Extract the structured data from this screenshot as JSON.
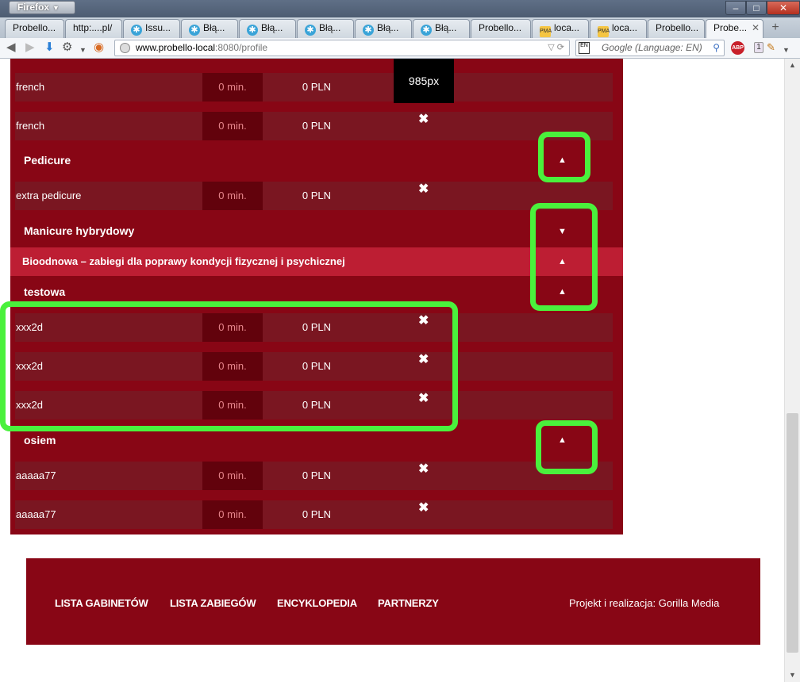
{
  "browser": {
    "menu_button": "Firefox",
    "tabs": [
      {
        "label": "Probello..."
      },
      {
        "label": "http:....pl/"
      },
      {
        "label": "Issu..."
      },
      {
        "label": "Błą..."
      },
      {
        "label": "Błą..."
      },
      {
        "label": "Błą..."
      },
      {
        "label": "Błą..."
      },
      {
        "label": "Błą..."
      },
      {
        "label": "Probello..."
      },
      {
        "label": "loca..."
      },
      {
        "label": "loca..."
      },
      {
        "label": "Probello..."
      },
      {
        "label": "Probe..."
      }
    ],
    "url_domain": "www.probello-local",
    "url_rest": ":8080/profile",
    "search_placeholder": "Google (Language: EN)",
    "search_engine_badge": "EN",
    "adblock_label": "ABP",
    "addon_count": "1"
  },
  "page": {
    "tooltip": "985px",
    "rows_top": [
      {
        "name": "french",
        "duration": "0 min.",
        "price": "0 PLN"
      },
      {
        "name": "french",
        "duration": "0 min.",
        "price": "0 PLN",
        "remove": "✖"
      }
    ],
    "categories": {
      "pedicure": "Pedicure",
      "manicure": "Manicure hybrydowy",
      "bioodnowa": "Bioodnowa – zabiegi dla poprawy kondycji fizycznej i psychicznej",
      "testowa": "testowa",
      "osiem": "osiem"
    },
    "toggle_up": "▲",
    "toggle_down": "▼",
    "pedicure_rows": [
      {
        "name": "extra pedicure",
        "duration": "0 min.",
        "price": "0 PLN",
        "remove": "✖"
      }
    ],
    "testowa_rows": [
      {
        "name": "xxx2d",
        "duration": "0 min.",
        "price": "0 PLN",
        "remove": "✖"
      },
      {
        "name": "xxx2d",
        "duration": "0 min.",
        "price": "0 PLN",
        "remove": "✖"
      },
      {
        "name": "xxx2d",
        "duration": "0 min.",
        "price": "0 PLN",
        "remove": "✖"
      }
    ],
    "osiem_rows": [
      {
        "name": "aaaaa77",
        "duration": "0 min.",
        "price": "0 PLN",
        "remove": "✖"
      },
      {
        "name": "aaaaa77",
        "duration": "0 min.",
        "price": "0 PLN",
        "remove": "✖"
      }
    ]
  },
  "footer": {
    "links": [
      "LISTA GABINETÓW",
      "LISTA ZABIEGÓW",
      "ENCYKLOPEDIA",
      "PARTNERZY"
    ],
    "credit": "Projekt i realizacja: Gorilla Media"
  },
  "colors": {
    "panel": "#880615",
    "highlight": "#bd1e33",
    "annotation": "#4af13c"
  }
}
